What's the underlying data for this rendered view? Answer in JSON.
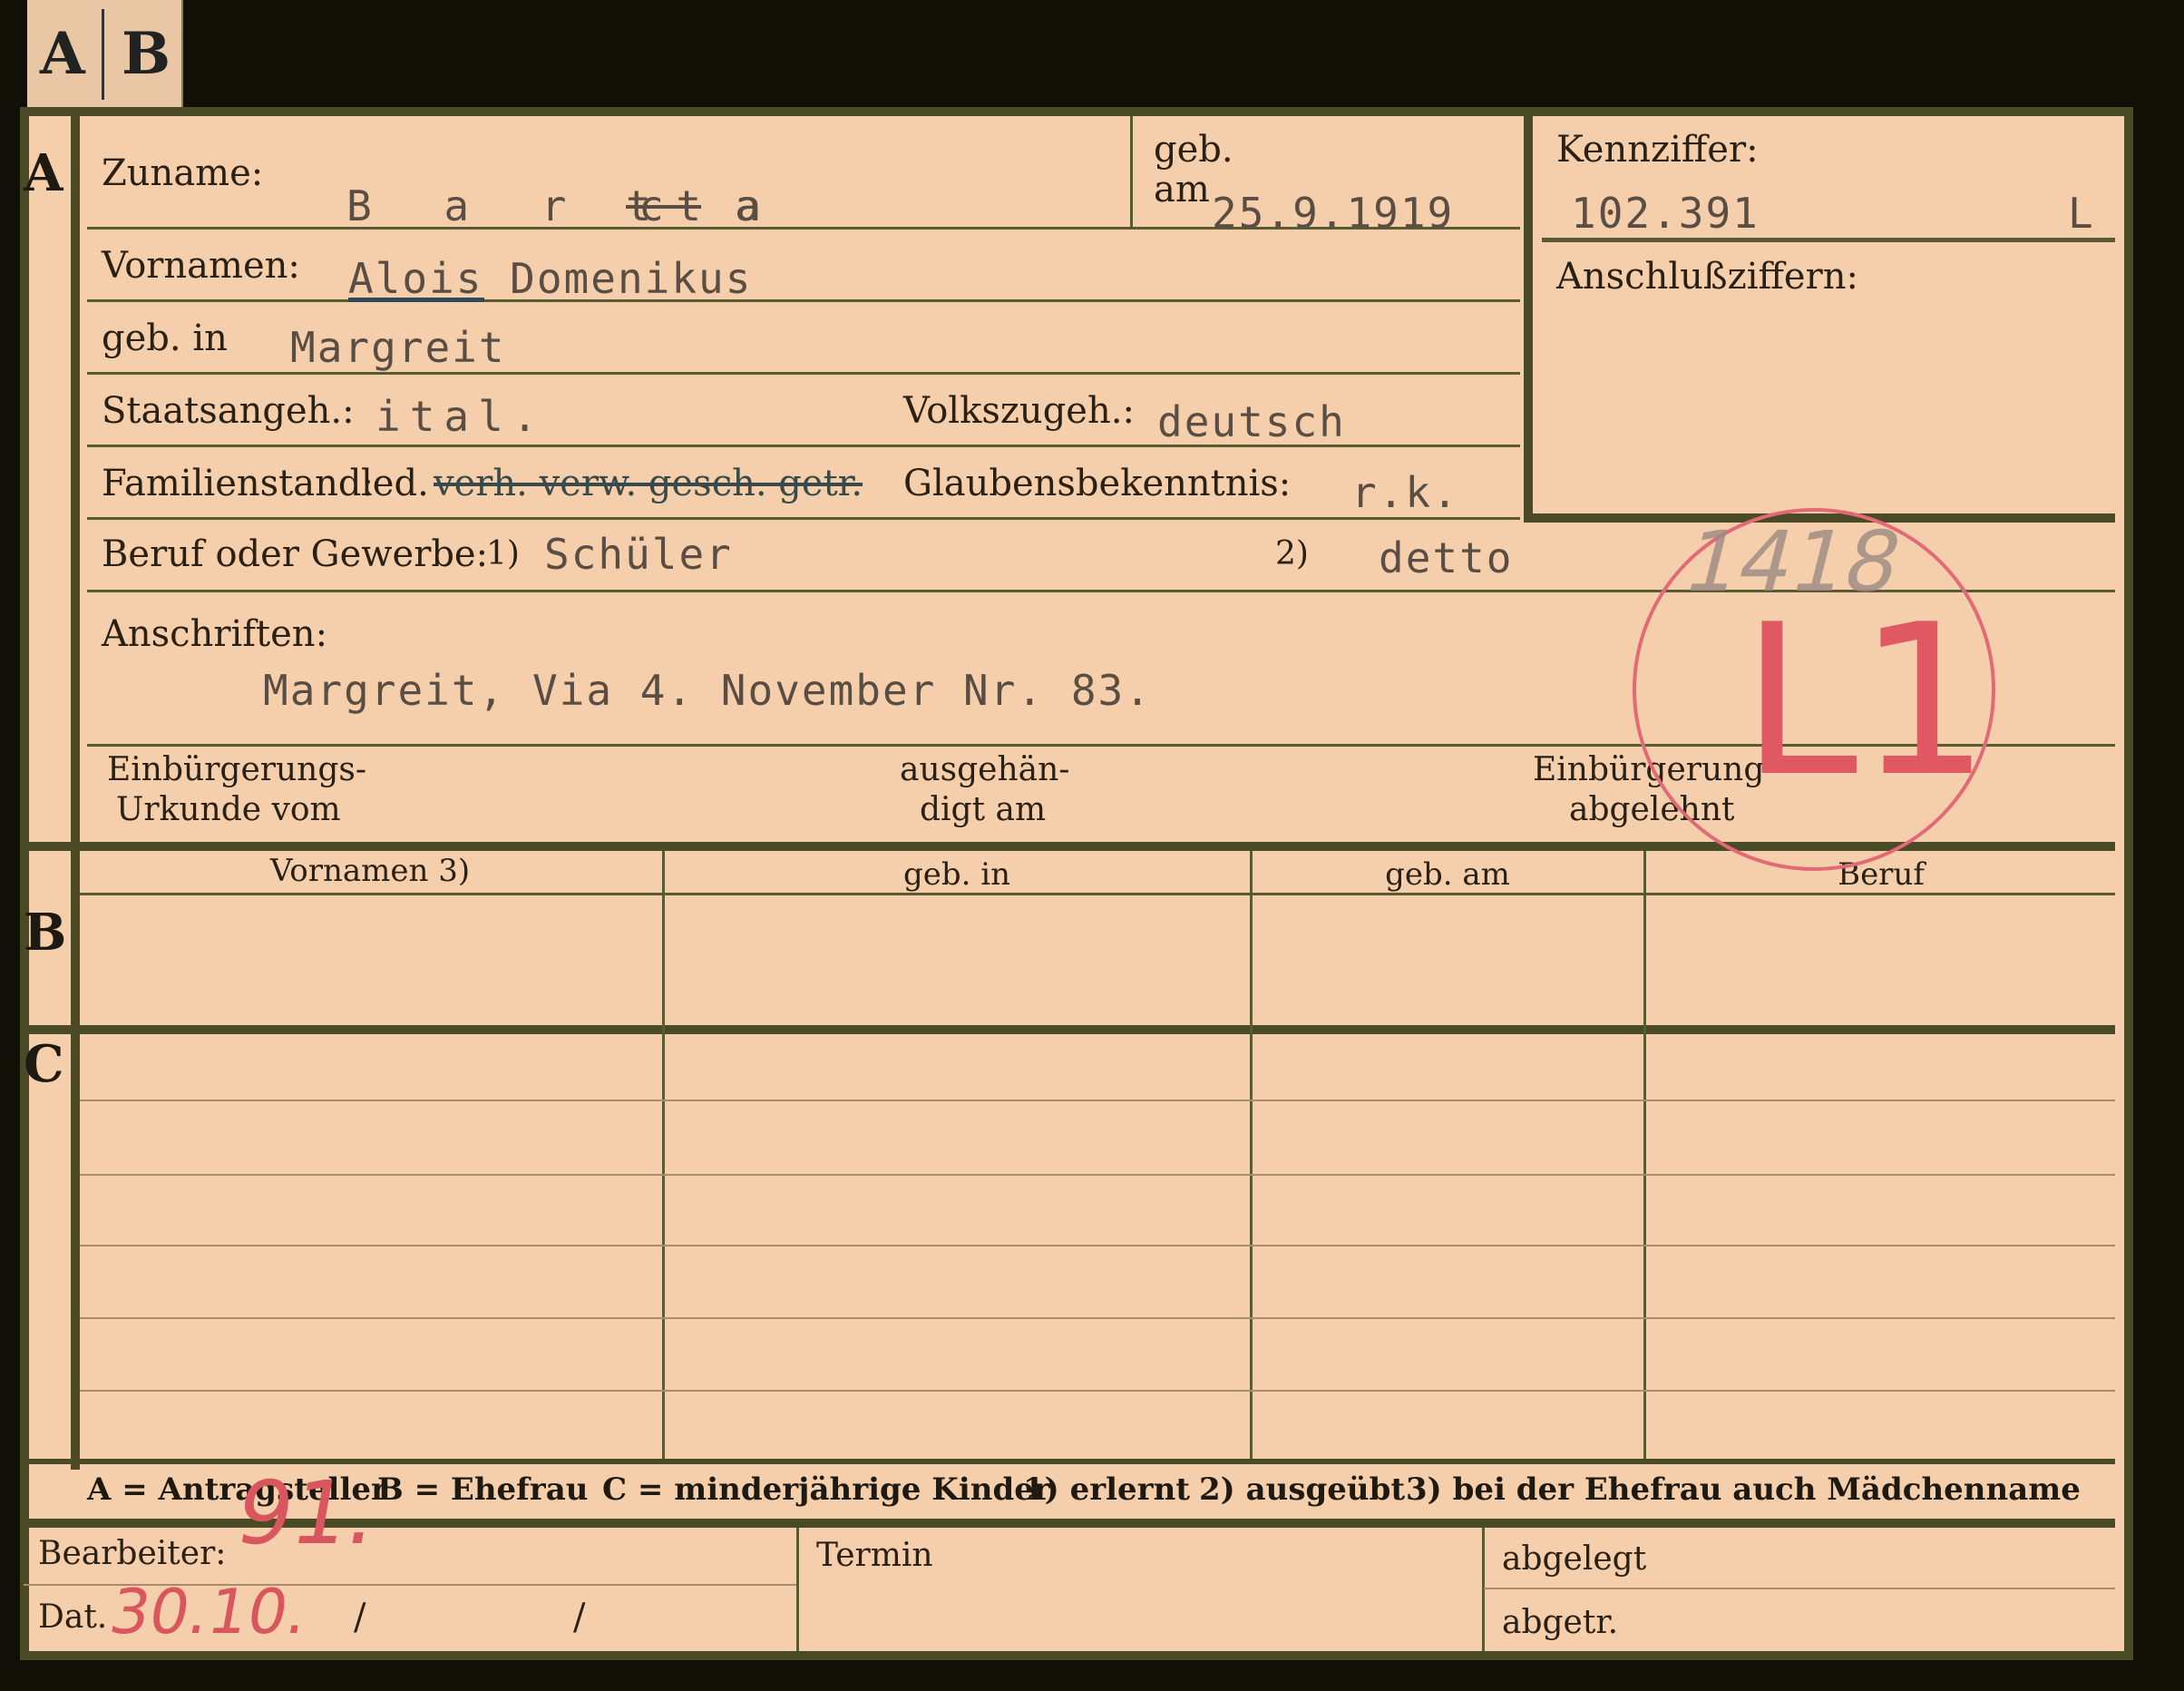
{
  "tab": {
    "letter_a": "A",
    "letter_b": "B"
  },
  "sections": {
    "a": "A",
    "b": "B",
    "c": "C"
  },
  "header": {
    "zuname_label": "Zuname:",
    "zuname_value_start": "B a r c a",
    "zuname_value_struck": "t t",
    "zuname_value_end": "a",
    "geb_label": "geb.",
    "am_label": "am",
    "geb_am_value": "25.9.1919",
    "kennziffer_label": "Kennziffer:",
    "kennziffer_value": "102.391",
    "kennziffer_suffix": "L",
    "anschluss_label": "Anschlußziffern:"
  },
  "fields": {
    "vornamen_label": "Vornamen:",
    "vornamen_value": "Alois Domenikus",
    "geb_in_label": "geb. in",
    "geb_in_value": "Margreit",
    "staats_label": "Staatsangeh.:",
    "staats_value": "ital.",
    "volks_label": "Volkszugeh.:",
    "volks_value": "deutsch",
    "familien_label": "Familienstand:",
    "familien_led": "led.",
    "familien_struck": "verh. verw. gesch. getr.",
    "glaubens_label": "Glaubensbekenntnis:",
    "glaubens_value": "r.k.",
    "beruf_label": "Beruf oder Gewerbe:",
    "beruf_mark1": "1)",
    "beruf_value1": "Schüler",
    "beruf_mark2": "2)",
    "beruf_value2": "detto",
    "anschriften_label": "Anschriften:",
    "anschriften_value": "Margreit, Via 4. November Nr. 83.",
    "einb_urk_1": "Einbürgerungs-",
    "einb_urk_2": "Urkunde vom",
    "ausgeh_1": "ausgehän-",
    "ausgeh_2": "digt am",
    "einb_abg_1": "Einbürgerung",
    "einb_abg_2": "abgelehnt"
  },
  "table": {
    "headers": [
      "Vornamen 3)",
      "geb. in",
      "geb. am",
      "Beruf"
    ]
  },
  "legend": {
    "a": "A = Antragsteller",
    "b": "B = Ehefrau",
    "c": "C = minderjährige Kinder",
    "n1": "1) erlernt",
    "n2": "2) ausgeübt",
    "n3": "3) bei der Ehefrau auch Mädchenname"
  },
  "bottom": {
    "bearbeiter_label": "Bearbeiter:",
    "bearbeiter_value": "91.",
    "termin_label": "Termin",
    "abgelegt_label": "abgelegt",
    "dat_label": "Dat.",
    "dat_value": "30.10.",
    "slash1": "/",
    "slash2": "/",
    "abgetr_label": "abgetr."
  },
  "stamp": {
    "number": "1418",
    "code": "L1"
  }
}
